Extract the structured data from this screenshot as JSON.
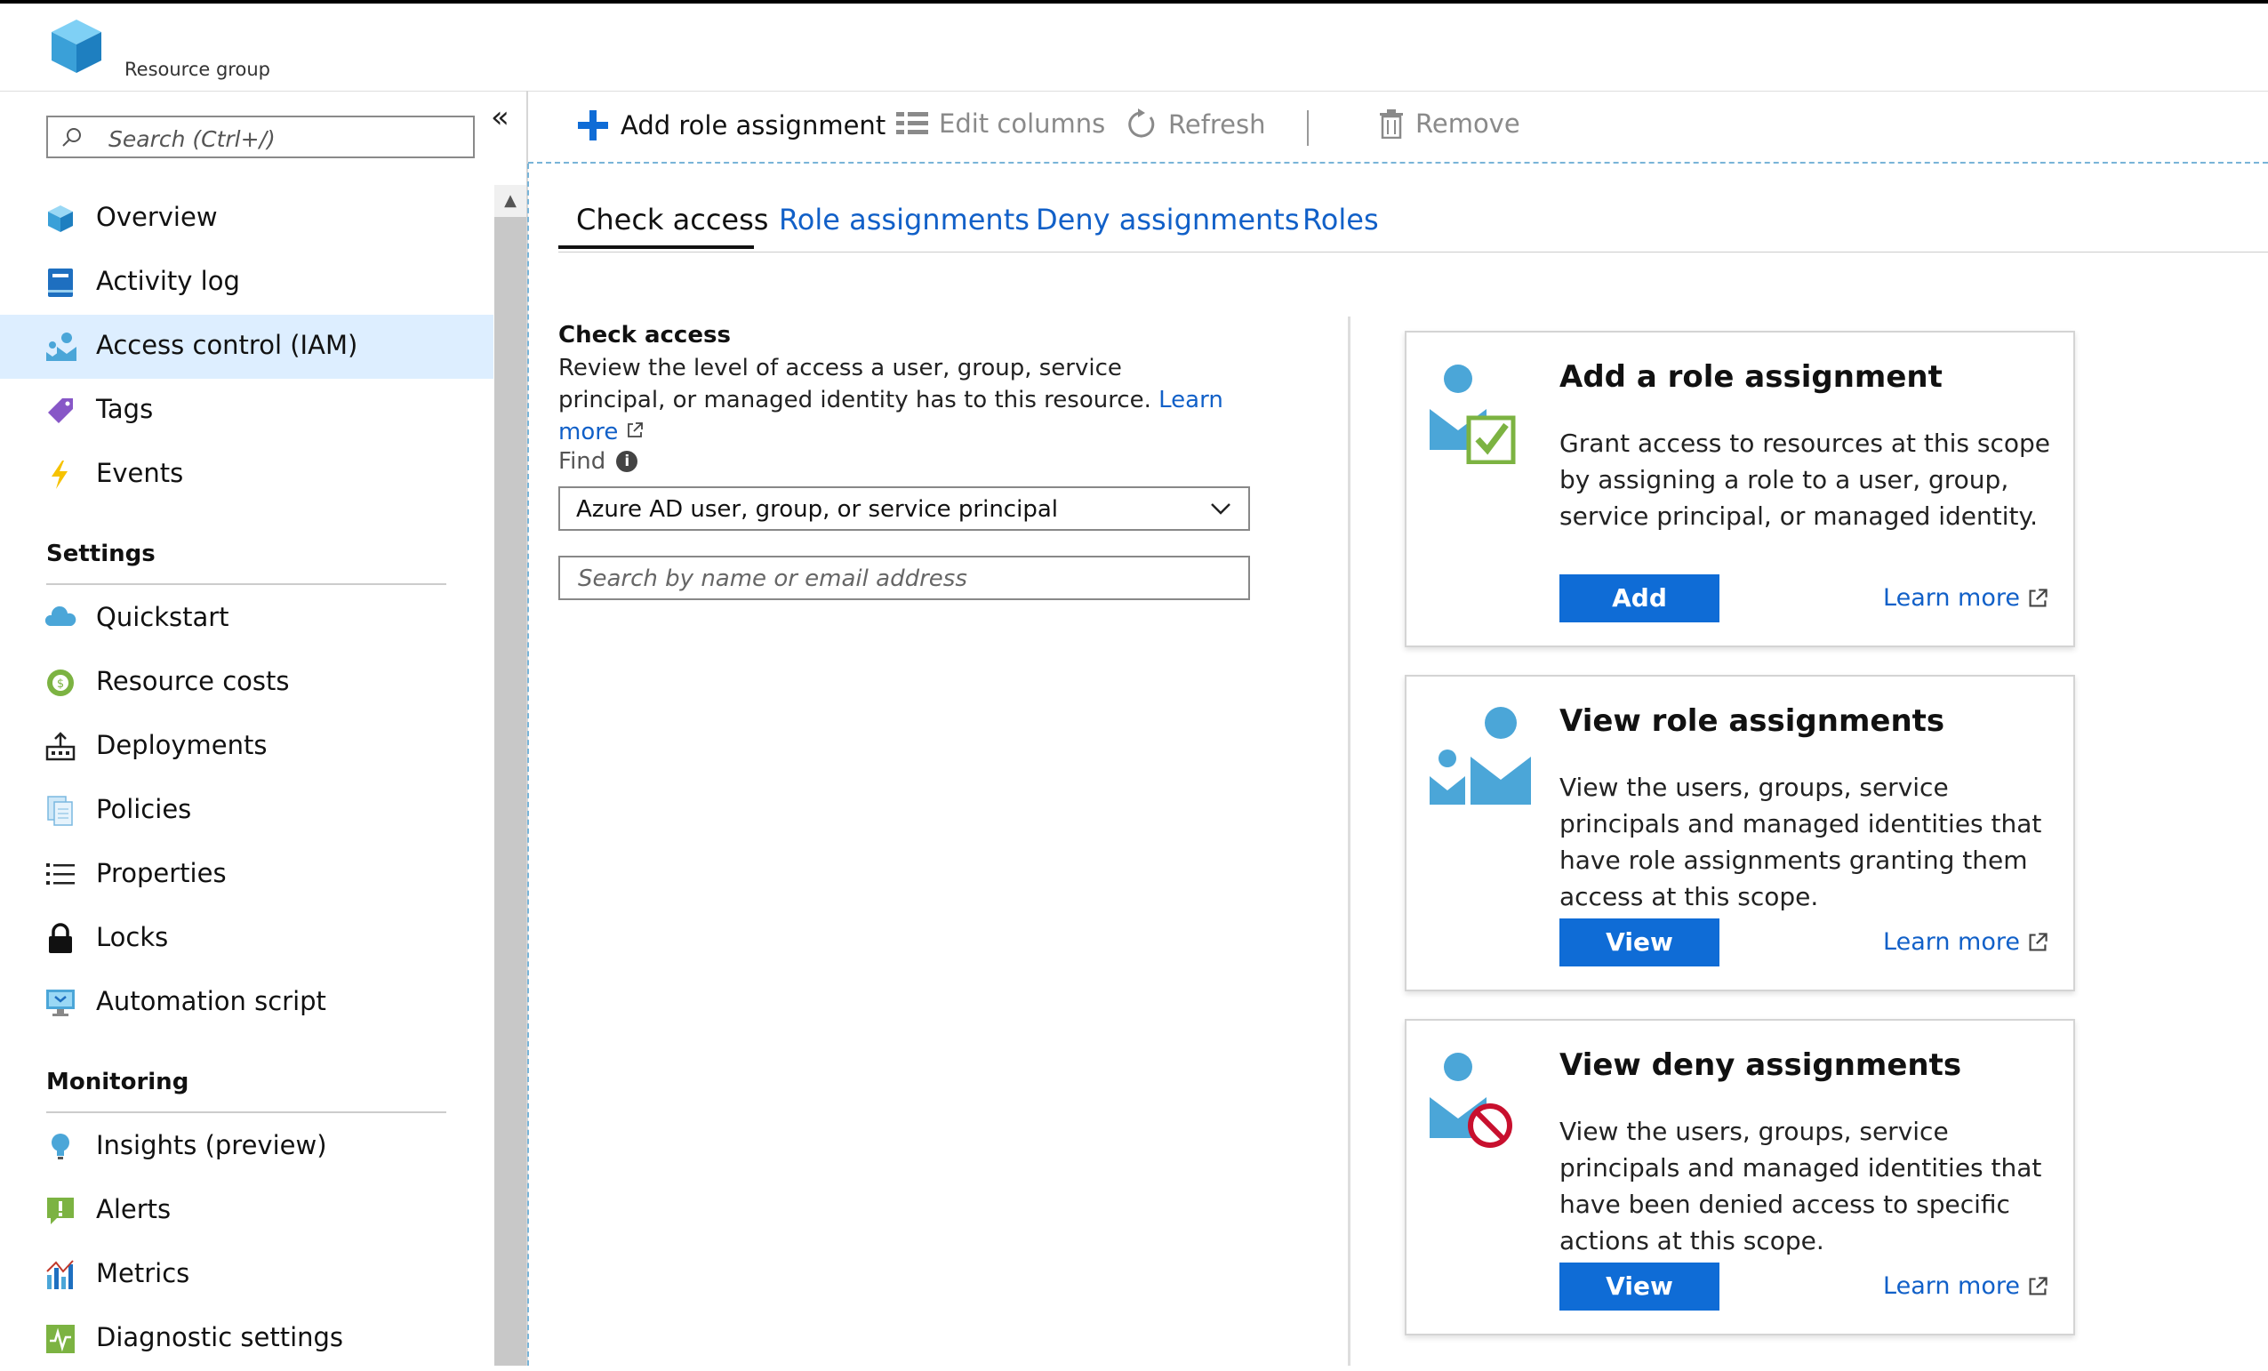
{
  "header": {
    "resource_type": "Resource group"
  },
  "sidebar": {
    "search_placeholder": "Search (Ctrl+/)",
    "collapse_glyph": "«",
    "scroll_up_glyph": "▲",
    "items": [
      {
        "label": "Overview",
        "icon": "cube-icon"
      },
      {
        "label": "Activity log",
        "icon": "activity-log-icon"
      },
      {
        "label": "Access control (IAM)",
        "icon": "iam-icon",
        "active": true
      },
      {
        "label": "Tags",
        "icon": "tag-icon"
      },
      {
        "label": "Events",
        "icon": "lightning-icon"
      }
    ],
    "settings": {
      "title": "Settings",
      "items": [
        {
          "label": "Quickstart",
          "icon": "cloud-icon"
        },
        {
          "label": "Resource costs",
          "icon": "costs-icon"
        },
        {
          "label": "Deployments",
          "icon": "deployments-icon"
        },
        {
          "label": "Policies",
          "icon": "policies-icon"
        },
        {
          "label": "Properties",
          "icon": "properties-icon"
        },
        {
          "label": "Locks",
          "icon": "lock-icon"
        },
        {
          "label": "Automation script",
          "icon": "automation-icon"
        }
      ]
    },
    "monitoring": {
      "title": "Monitoring",
      "items": [
        {
          "label": "Insights (preview)",
          "icon": "bulb-icon"
        },
        {
          "label": "Alerts",
          "icon": "alert-icon"
        },
        {
          "label": "Metrics",
          "icon": "metrics-icon"
        },
        {
          "label": "Diagnostic settings",
          "icon": "diagnostic-icon"
        }
      ]
    }
  },
  "toolbar": {
    "add": "Add role assignment",
    "edit_columns": "Edit columns",
    "refresh": "Refresh",
    "separator": "|",
    "remove": "Remove"
  },
  "tabs": [
    "Check access",
    "Role assignments",
    "Deny assignments",
    "Roles"
  ],
  "check_access": {
    "title": "Check access",
    "description": "Review the level of access a user, group, service principal, or managed identity has to this resource.",
    "learn_more": "Learn more",
    "find_label": "Find",
    "info_glyph": "i",
    "find_value": "Azure AD user, group, or service principal",
    "search_placeholder": "Search by name or email address"
  },
  "cards": [
    {
      "title": "Add a role assignment",
      "description": "Grant access to resources at this scope by assigning a role to a user, group, service principal, or managed identity.",
      "button": "Add",
      "learn_more": "Learn more"
    },
    {
      "title": "View role assignments",
      "description": "View the users, groups, service principals and managed identities that have role assignments granting them access at this scope.",
      "button": "View",
      "learn_more": "Learn more"
    },
    {
      "title": "View deny assignments",
      "description": "View the users, groups, service principals and managed identities that have been denied access to specific actions at this scope.",
      "button": "View",
      "learn_more": "Learn more"
    }
  ],
  "colors": {
    "accent": "#0f6cd6",
    "link": "#1160c8",
    "active_bg": "#ddeeff",
    "person": "#4ba6d8",
    "check_green": "#7cb342",
    "deny_red": "#c8102e"
  }
}
